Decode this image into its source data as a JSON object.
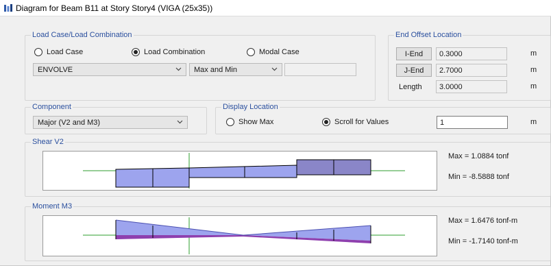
{
  "window": {
    "title": "Diagram for Beam B11 at Story Story4 (VIGA (25x35))"
  },
  "load_case": {
    "group_label": "Load Case/Load Combination",
    "options": [
      "Load Case",
      "Load Combination",
      "Modal Case"
    ],
    "selected_option": "Load Combination",
    "combination_value": "ENVOLVE",
    "type_value": "Max and Min",
    "extra_value": ""
  },
  "end_offset": {
    "group_label": "End Offset Location",
    "i_end_label": "I-End",
    "i_end_value": "0.3000",
    "j_end_label": "J-End",
    "j_end_value": "2.7000",
    "length_label": "Length",
    "length_value": "3.0000",
    "unit": "m"
  },
  "component": {
    "group_label": "Component",
    "value": "Major (V2 and M3)"
  },
  "display_location": {
    "group_label": "Display Location",
    "options": [
      "Show Max",
      "Scroll for Values"
    ],
    "selected_option": "Scroll for Values",
    "value": "1",
    "unit": "m"
  },
  "shear": {
    "group_label": "Shear V2",
    "max_label": "Max = 1.0884 tonf",
    "min_label": "Min = -8.5888 tonf",
    "colors": {
      "fill": "#9da4ee",
      "dark_fill": "#8a86c8",
      "stroke": "#000000",
      "axis": "#2e9e2e",
      "marker": "#2e9e2e"
    }
  },
  "moment": {
    "group_label": "Moment M3",
    "max_label": "Max = 1.6476 tonf-m",
    "min_label": "Min = -1.7140 tonf-m",
    "colors": {
      "fill": "#9da4ee",
      "min_fill": "#8e3fae",
      "axis": "#2e9e2e"
    }
  }
}
